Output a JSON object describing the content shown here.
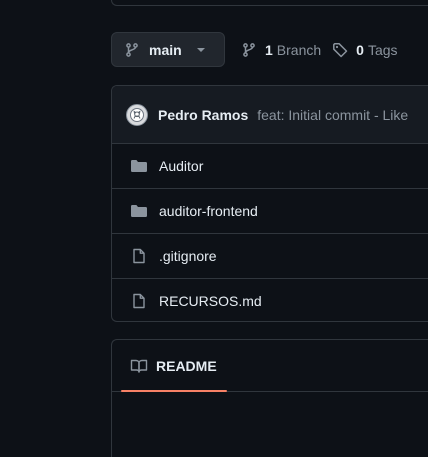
{
  "toolbar": {
    "branch": "main",
    "branches_count": "1",
    "branches_label": "Branch",
    "tags_count": "0",
    "tags_label": "Tags"
  },
  "commit": {
    "author": "Pedro Ramos",
    "message": "feat: Initial commit - Like"
  },
  "files": [
    {
      "name": "Auditor",
      "type": "folder",
      "icon": "folder-icon"
    },
    {
      "name": "auditor-frontend",
      "type": "folder",
      "icon": "folder-icon"
    },
    {
      "name": ".gitignore",
      "type": "file",
      "icon": "file-icon"
    },
    {
      "name": "RECURSOS.md",
      "type": "file",
      "icon": "file-icon"
    }
  ],
  "readme": {
    "tab_label": "README"
  },
  "colors": {
    "background": "#0d1117",
    "border": "#30363d",
    "muted_text": "#8b949e",
    "accent_underline": "#f78166"
  }
}
